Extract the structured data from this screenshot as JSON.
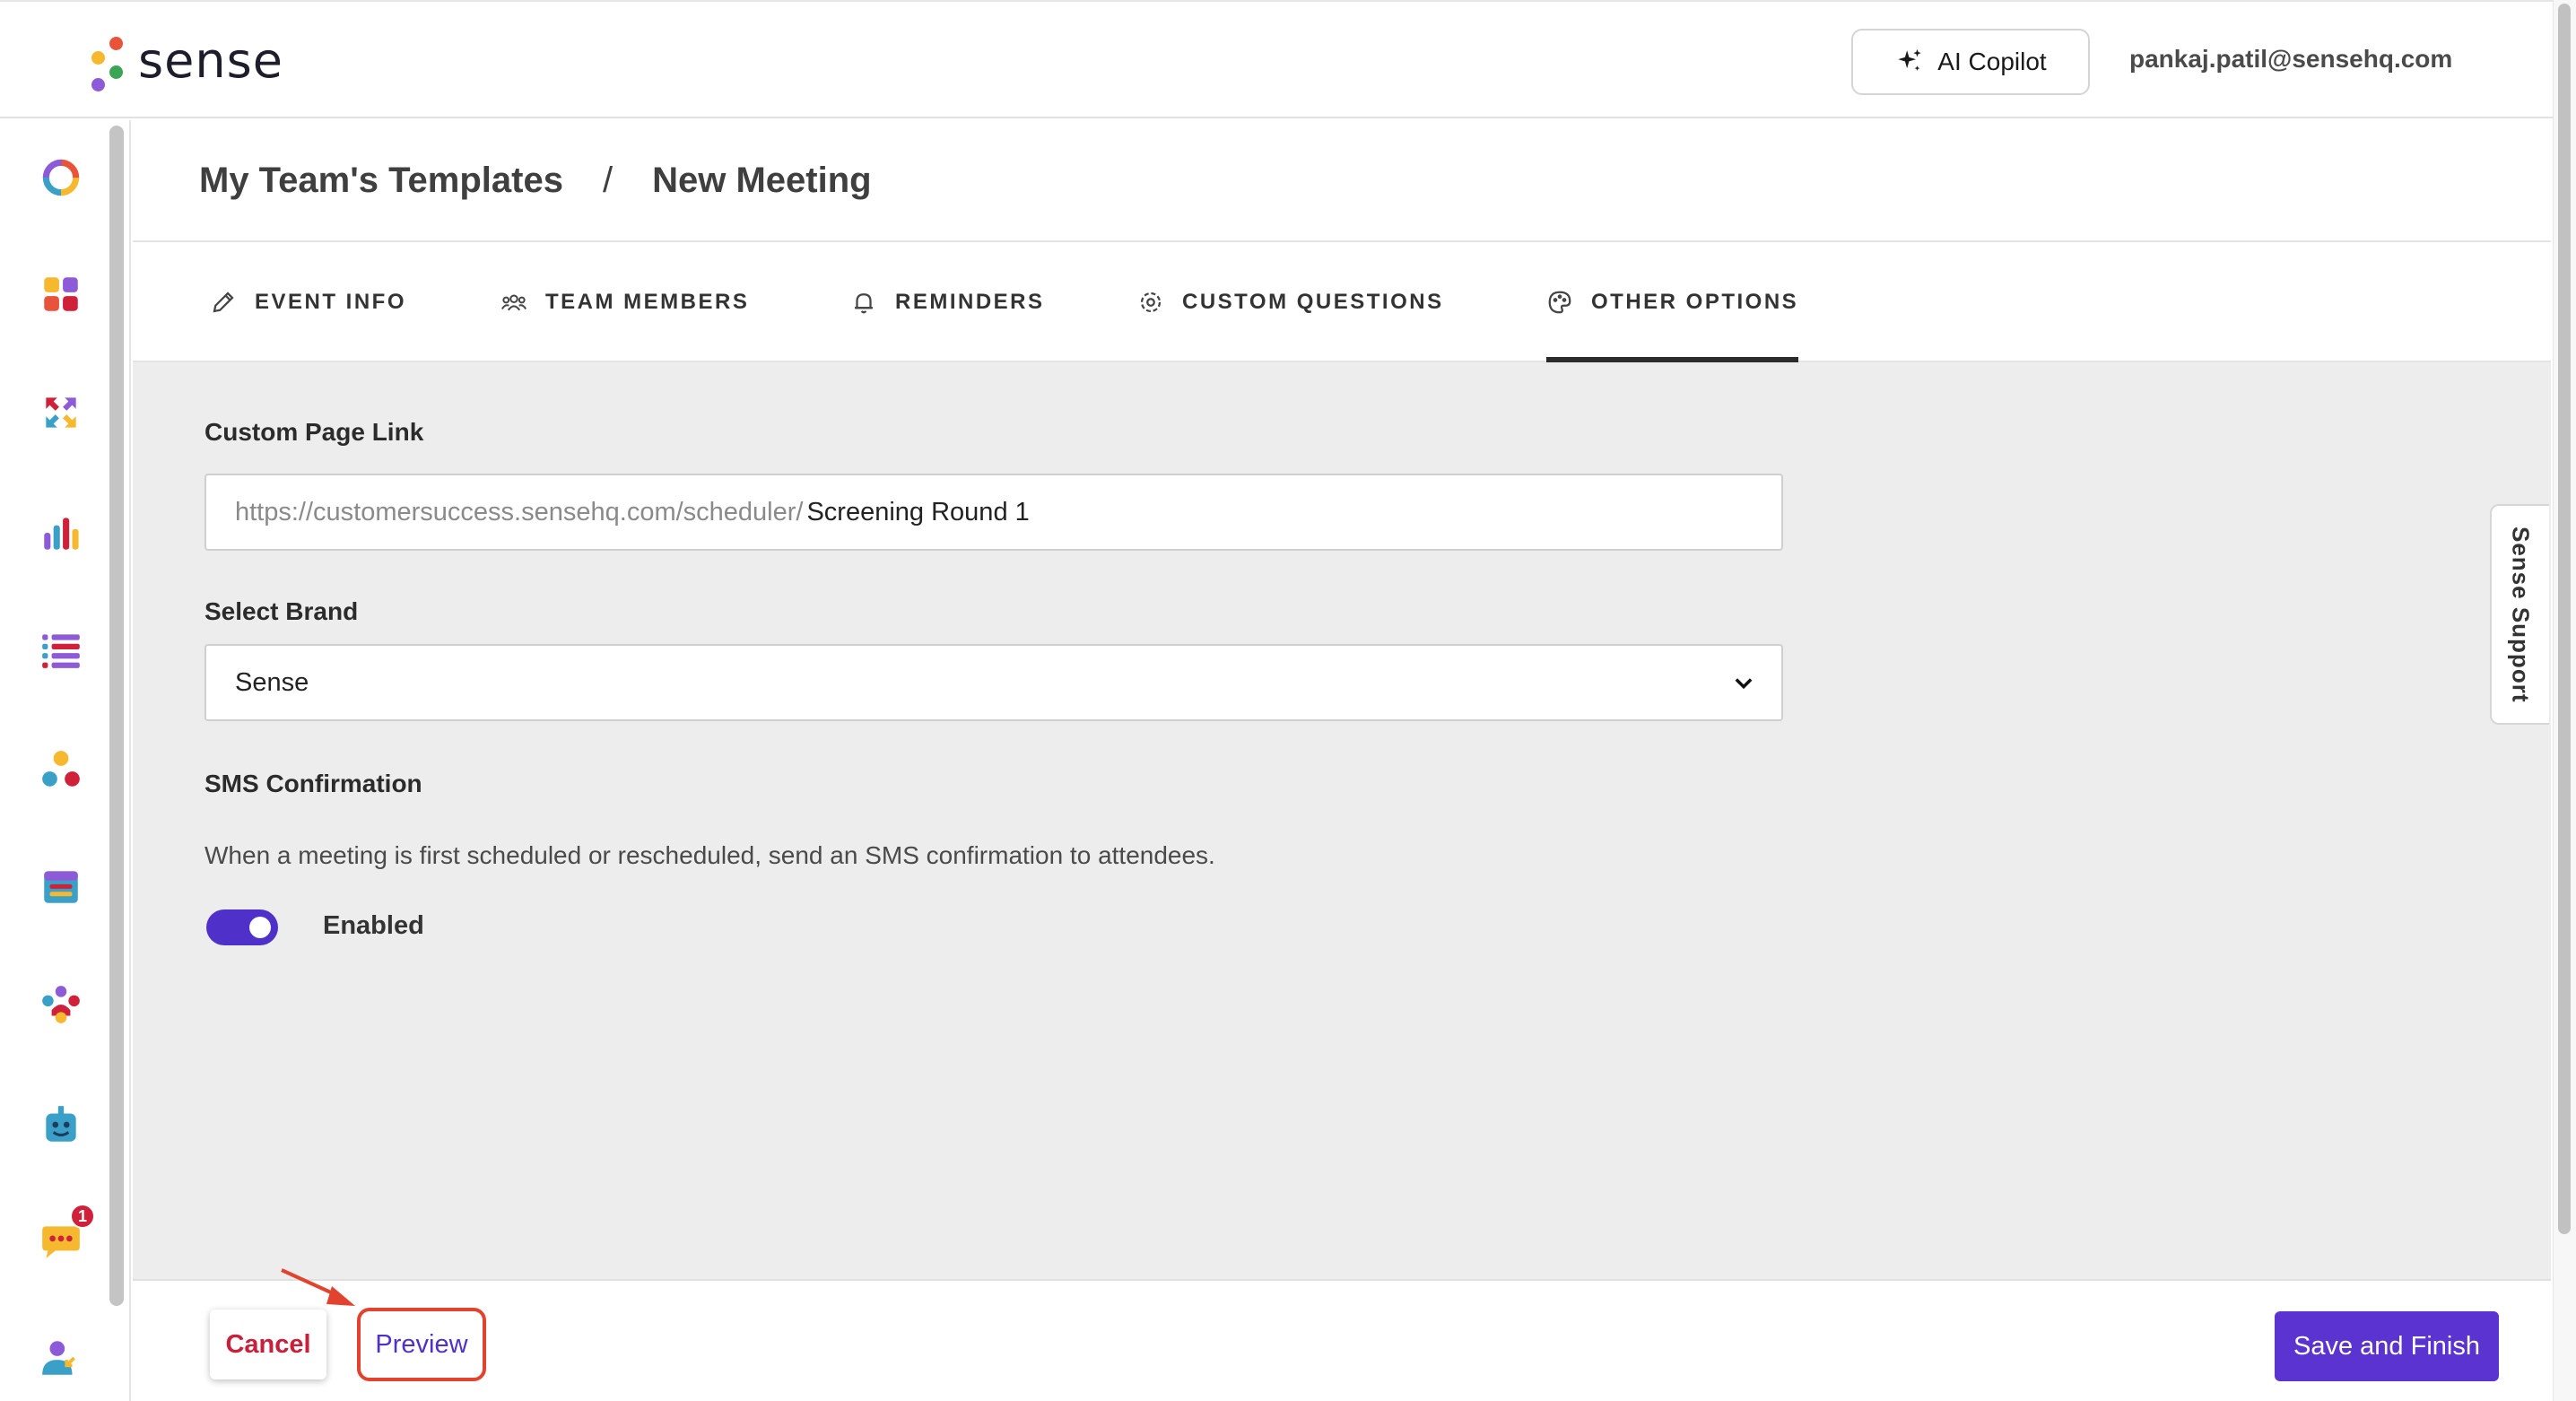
{
  "app": {
    "logo_text": "sense"
  },
  "header": {
    "copilot_label": "AI Copilot",
    "user_email": "pankaj.patil@sensehq.com"
  },
  "sidebar": {
    "items": [
      {
        "icon": "ring-icon"
      },
      {
        "icon": "grid-icon"
      },
      {
        "icon": "arrows-icon"
      },
      {
        "icon": "bar-chart-icon"
      },
      {
        "icon": "list-icon"
      },
      {
        "icon": "workflow-icon"
      },
      {
        "icon": "calendar-icon"
      },
      {
        "icon": "people-icon"
      },
      {
        "icon": "chatbot-icon"
      },
      {
        "icon": "messages-icon",
        "badge": "1"
      },
      {
        "icon": "user-icon"
      }
    ]
  },
  "breadcrumb": {
    "parent": "My Team's Templates",
    "separator": "/",
    "current": "New Meeting"
  },
  "tabs": [
    {
      "label": "EVENT INFO",
      "icon": "pencil-icon"
    },
    {
      "label": "TEAM MEMBERS",
      "icon": "team-icon"
    },
    {
      "label": "REMINDERS",
      "icon": "bell-icon"
    },
    {
      "label": "CUSTOM QUESTIONS",
      "icon": "gear-icon"
    },
    {
      "label": "OTHER OPTIONS",
      "icon": "palette-icon",
      "active": true
    }
  ],
  "form": {
    "custom_link": {
      "label": "Custom Page Link",
      "prefix": "https://customersuccess.sensehq.com/scheduler/",
      "value": "Screening Round 1"
    },
    "brand": {
      "label": "Select Brand",
      "selected": "Sense"
    },
    "sms": {
      "label": "SMS Confirmation",
      "description": "When a meeting is first scheduled or rescheduled, send an SMS confirmation to attendees.",
      "toggle_label": "Enabled",
      "enabled": true
    }
  },
  "footer": {
    "cancel_label": "Cancel",
    "preview_label": "Preview",
    "save_label": "Save and Finish"
  },
  "support": {
    "label": "Sense Support"
  },
  "colors": {
    "accent": "#5a33d0",
    "danger": "#c8203a",
    "highlight": "#e2432f",
    "content_bg": "#ededed"
  }
}
